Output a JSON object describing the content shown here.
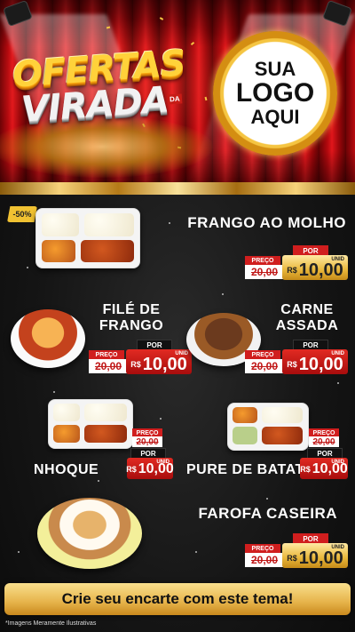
{
  "header": {
    "title_line1": "OFERTAS",
    "title_line2": "VIRADA",
    "title_small": "DA",
    "logo_line1": "SUA",
    "logo_line2": "LOGO",
    "logo_line3": "AQUI"
  },
  "badge": "-50%",
  "currency": "R$",
  "unit": "UNID",
  "preco_label": "PREÇO",
  "por_label": "POR",
  "old_price": "20,00",
  "old_prefix": "R$",
  "items": [
    {
      "name": "FRANGO AO MOLHO",
      "new_price": "10,00",
      "style": "gold"
    },
    {
      "name": "FILÉ DE FRANGO",
      "new_price": "10,00",
      "style": "red"
    },
    {
      "name": "CARNE ASSADA",
      "new_price": "10,00",
      "style": "red"
    },
    {
      "name": "NHOQUE",
      "new_price": "10,00",
      "style": "red"
    },
    {
      "name": "PURE DE BATATA",
      "new_price": "10,00",
      "style": "red"
    },
    {
      "name": "FAROFA CASEIRA",
      "new_price": "10,00",
      "style": "gold"
    }
  ],
  "footer": {
    "cta": "Crie seu encarte com este tema!",
    "disclaimer": "*Imagens Meramente Ilustrativas"
  }
}
